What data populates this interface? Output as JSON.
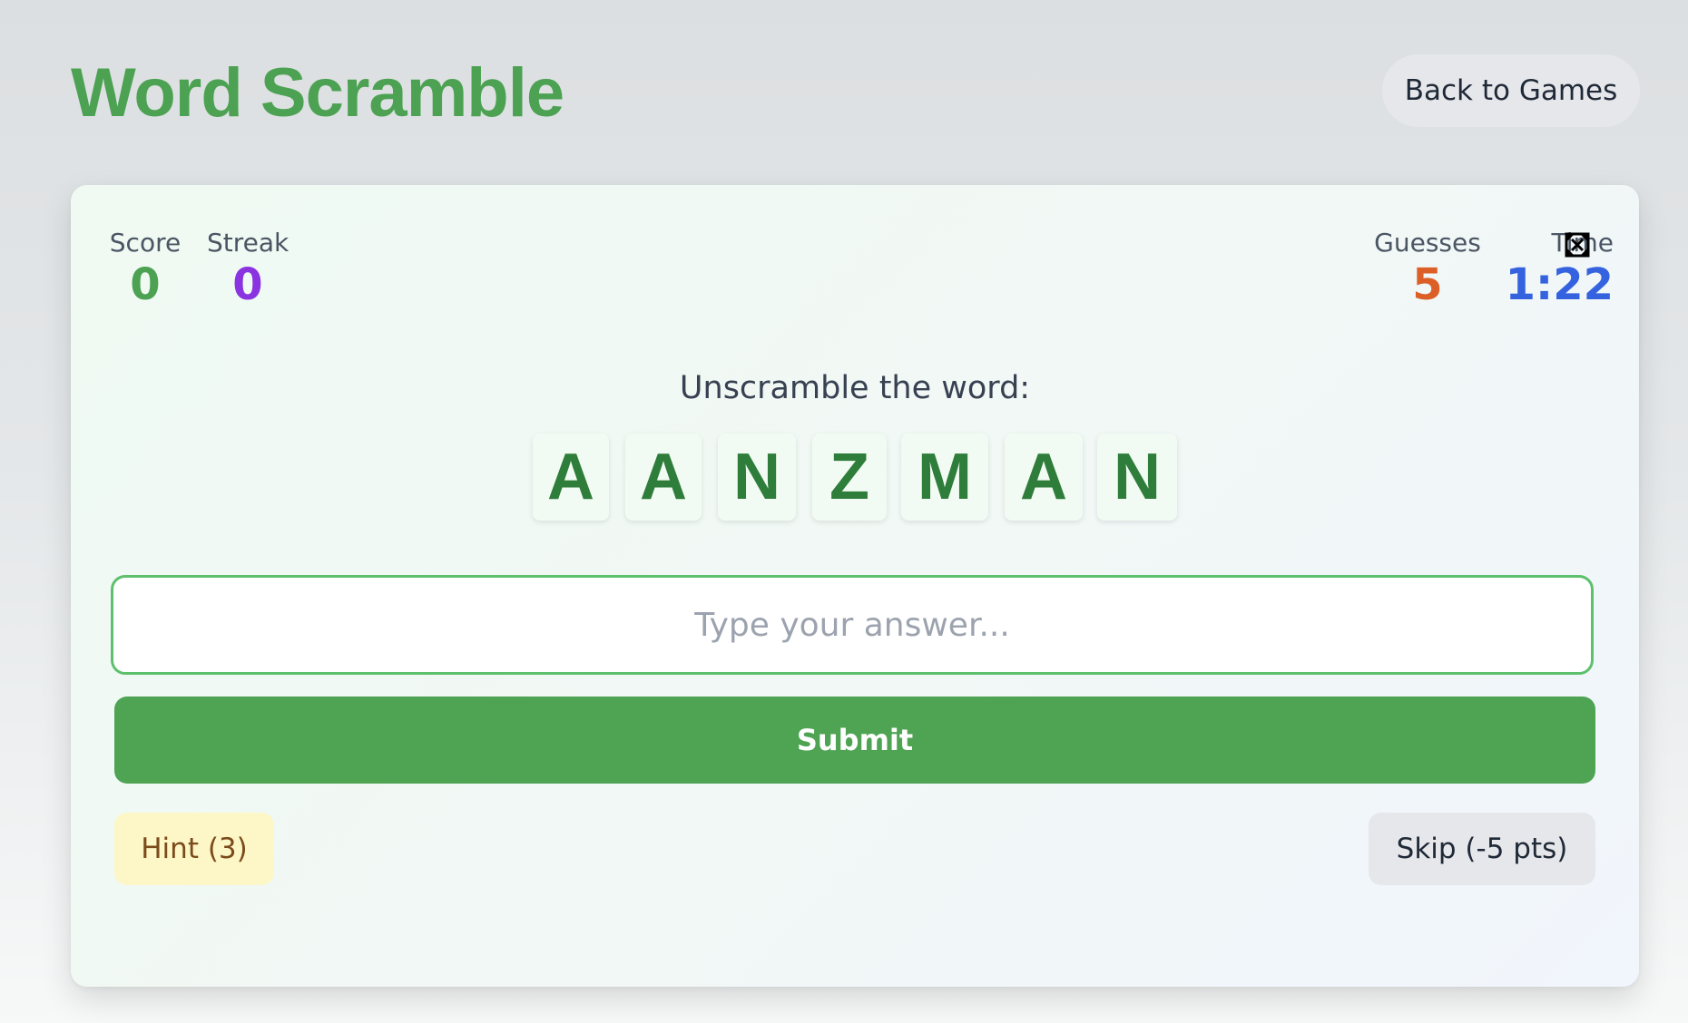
{
  "header": {
    "title": "Word Scramble",
    "back_label": "Back to Games"
  },
  "stats": {
    "score": {
      "label": "Score",
      "value": "0",
      "color": "#4ca252"
    },
    "streak": {
      "label": "Streak",
      "value": "0",
      "color": "#8a33e0"
    },
    "guesses": {
      "label": "Guesses",
      "value": "5",
      "color": "#dc5f28"
    },
    "time": {
      "label": "Time",
      "value": "1:22",
      "color": "#3563e0"
    }
  },
  "puzzle": {
    "prompt": "Unscramble the word:",
    "letters": [
      "A",
      "A",
      "N",
      "Z",
      "M",
      "A",
      "N"
    ]
  },
  "answer": {
    "placeholder": "Type your answer...",
    "value": ""
  },
  "actions": {
    "submit_label": "Submit",
    "hint_label": "Hint (3)",
    "skip_label": "Skip (-5 pts)"
  },
  "icons": {
    "fullscreen": "fullscreen-icon"
  },
  "colors": {
    "brand_green": "#4ca252",
    "tile_letter": "#2e7d3a",
    "input_border": "#5dc06c"
  }
}
